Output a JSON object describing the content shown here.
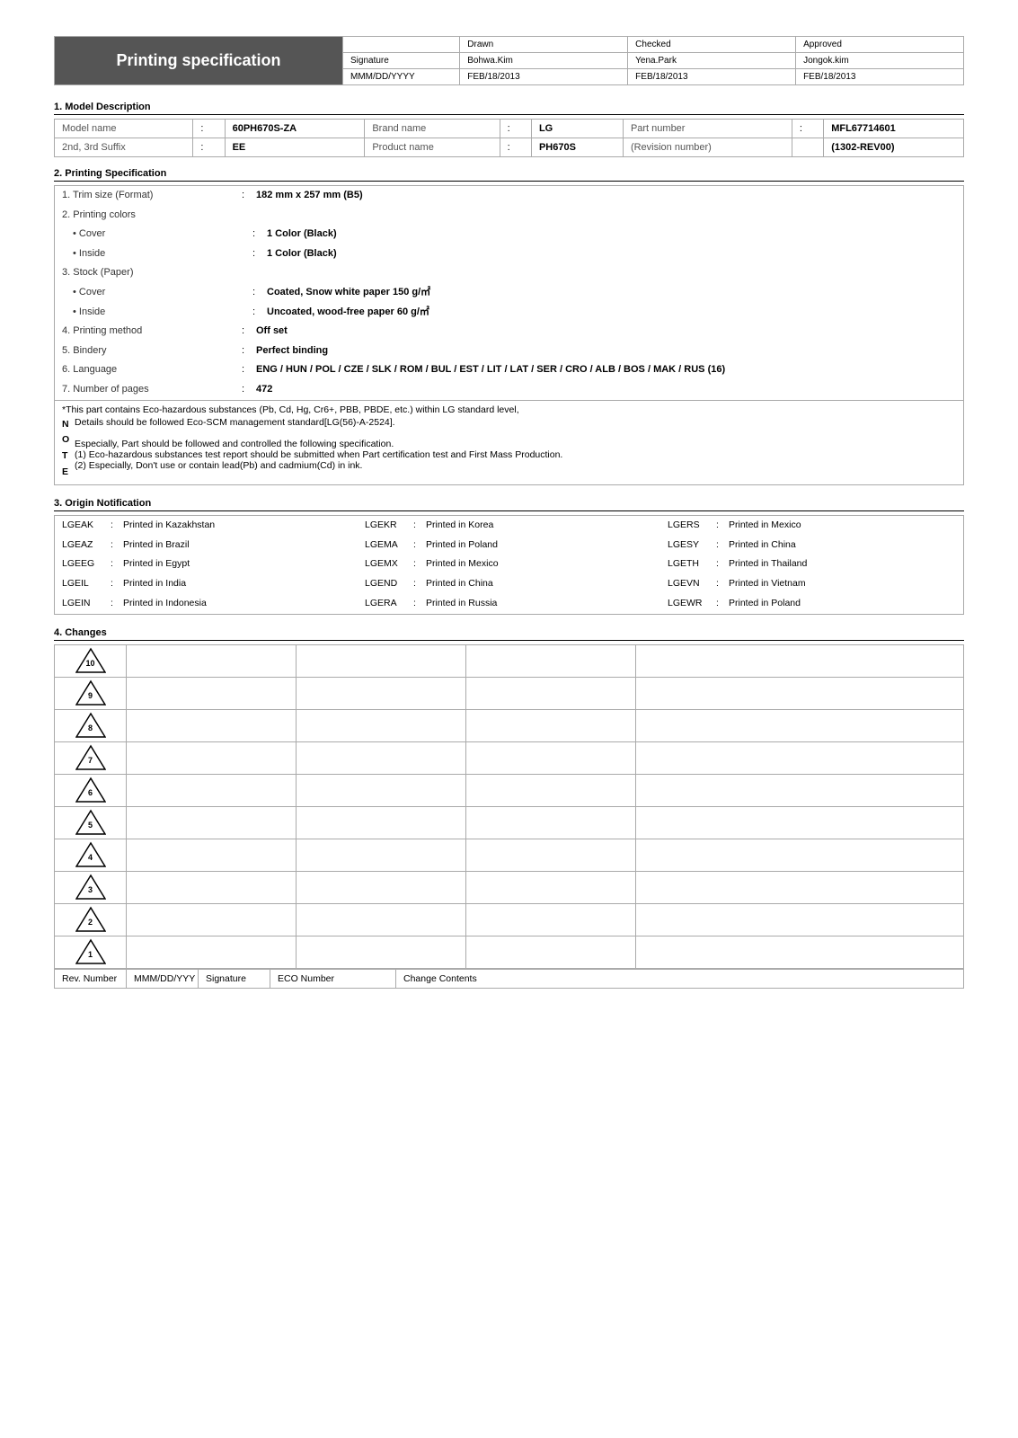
{
  "header": {
    "title": "Printing specification",
    "rows": {
      "labels": [
        "",
        "Drawn",
        "Checked",
        "Approved"
      ],
      "row1": [
        "Signature",
        "Bohwa.Kim",
        "Yena.Park",
        "Jongok.kim"
      ],
      "row2": [
        "MMM/DD/YYYY",
        "FEB/18/2013",
        "FEB/18/2013",
        "FEB/18/2013"
      ]
    }
  },
  "sections": {
    "model": {
      "title": "1. Model Description",
      "rows": [
        [
          "Model name",
          ":",
          "60PH670S-ZA",
          "Brand name",
          ":",
          "LG",
          "Part number",
          ":",
          "MFL67714601"
        ],
        [
          "2nd, 3rd Suffix",
          ":",
          "EE",
          "Product name",
          ":",
          "PH670S",
          "(Revision number)",
          "",
          "(1302-REV00)"
        ]
      ]
    },
    "printing": {
      "title": "2. Printing Specification",
      "items": [
        {
          "num": "1. Trim size (Format)",
          "sep": ":",
          "val": "182 mm x 257 mm (B5)",
          "bold": true,
          "indent": 0
        },
        {
          "num": "2. Printing colors",
          "sep": "",
          "val": "",
          "bold": false,
          "indent": 0
        },
        {
          "num": "• Cover",
          "sep": ":",
          "val": "1 Color (Black)",
          "bold": true,
          "indent": 2
        },
        {
          "num": "• Inside",
          "sep": ":",
          "val": "1 Color (Black)",
          "bold": true,
          "indent": 2
        },
        {
          "num": "3. Stock (Paper)",
          "sep": "",
          "val": "",
          "bold": false,
          "indent": 0
        },
        {
          "num": "• Cover",
          "sep": ":",
          "val": "Coated, Snow white paper 150 g/㎡",
          "bold": true,
          "indent": 2
        },
        {
          "num": "• Inside",
          "sep": ":",
          "val": "Uncoated, wood-free paper 60 g/㎡",
          "bold": true,
          "indent": 2
        },
        {
          "num": "4. Printing method",
          "sep": ":",
          "val": "Off set",
          "bold": true,
          "indent": 0
        },
        {
          "num": "5. Bindery",
          "sep": ":",
          "val": "Perfect binding",
          "bold": true,
          "indent": 0
        },
        {
          "num": "6. Language",
          "sep": ":",
          "val": "ENG / HUN / POL / CZE / SLK / ROM / BUL / EST / LIT / LAT / SER / CRO / ALB / BOS / MAK / RUS (16)",
          "bold": true,
          "indent": 0
        },
        {
          "num": "7. Number of pages",
          "sep": ":",
          "val": "472",
          "bold": true,
          "indent": 0
        }
      ],
      "notes": {
        "intro": "*This part contains Eco-hazardous substances (Pb, Cd, Hg, Cr6+, PBB, PBDE, etc.) within LG standard level,",
        "items": [
          {
            "letter": "N",
            "text": "Details should be followed Eco-SCM management standard[LG(56)-A-2524]."
          },
          {
            "letter": "O",
            "text": ""
          },
          {
            "letter": "T",
            "text": "Especially, Part should be followed and controlled the following specification."
          },
          {
            "letter": "E",
            "text": "(1) Eco-hazardous substances test report should be submitted when Part certification test and First Mass Production."
          },
          {
            "letter": "",
            "text": "(2) Especially, Don't use or contain lead(Pb) and cadmium(Cd) in ink."
          }
        ]
      }
    },
    "origin": {
      "title": "3. Origin Notification",
      "items": [
        {
          "col1": {
            "code": "LGEAK",
            "sep": ":",
            "val": "Printed in Kazakhstan"
          },
          "col2": {
            "code": "LGEKR",
            "sep": ":",
            "val": "Printed in Korea"
          },
          "col3": {
            "code": "LGERS",
            "sep": ":",
            "val": "Printed in Mexico"
          }
        },
        {
          "col1": {
            "code": "LGEAZ",
            "sep": ":",
            "val": "Printed in Brazil"
          },
          "col2": {
            "code": "LGEMA",
            "sep": ":",
            "val": "Printed in Poland"
          },
          "col3": {
            "code": "LGESY",
            "sep": ":",
            "val": "Printed in China"
          }
        },
        {
          "col1": {
            "code": "LGEEG",
            "sep": ":",
            "val": "Printed in Egypt"
          },
          "col2": {
            "code": "LGEMX",
            "sep": ":",
            "val": "Printed in Mexico"
          },
          "col3": {
            "code": "LGETH",
            "sep": ":",
            "val": "Printed in Thailand"
          }
        },
        {
          "col1": {
            "code": "LGEIL",
            "sep": ":",
            "val": "Printed in India"
          },
          "col2": {
            "code": "LGEND",
            "sep": ":",
            "val": "Printed in China"
          },
          "col3": {
            "code": "LGEVN",
            "sep": ":",
            "val": "Printed in Vietnam"
          }
        },
        {
          "col1": {
            "code": "LGEIN",
            "sep": ":",
            "val": "Printed in Indonesia"
          },
          "col2": {
            "code": "LGERA",
            "sep": ":",
            "val": "Printed in Russia"
          },
          "col3": {
            "code": "LGEWR",
            "sep": ":",
            "val": "Printed in Poland"
          }
        }
      ]
    },
    "changes": {
      "title": "4. Changes",
      "rows": [
        {
          "num": 10,
          "cols": [
            "",
            "",
            "",
            ""
          ]
        },
        {
          "num": 9,
          "cols": [
            "",
            "",
            "",
            ""
          ]
        },
        {
          "num": 8,
          "cols": [
            "",
            "",
            "",
            ""
          ]
        },
        {
          "num": 7,
          "cols": [
            "",
            "",
            "",
            ""
          ]
        },
        {
          "num": 6,
          "cols": [
            "",
            "",
            "",
            ""
          ]
        },
        {
          "num": 5,
          "cols": [
            "",
            "",
            "",
            ""
          ]
        },
        {
          "num": 4,
          "cols": [
            "",
            "",
            "",
            ""
          ]
        },
        {
          "num": 3,
          "cols": [
            "",
            "",
            "",
            ""
          ]
        },
        {
          "num": 2,
          "cols": [
            "",
            "",
            "",
            ""
          ]
        },
        {
          "num": 1,
          "cols": [
            "",
            "",
            "",
            ""
          ]
        }
      ],
      "footer": [
        "Rev. Number",
        "MMM/DD/YYY",
        "Signature",
        "ECO Number",
        "Change Contents"
      ]
    }
  }
}
